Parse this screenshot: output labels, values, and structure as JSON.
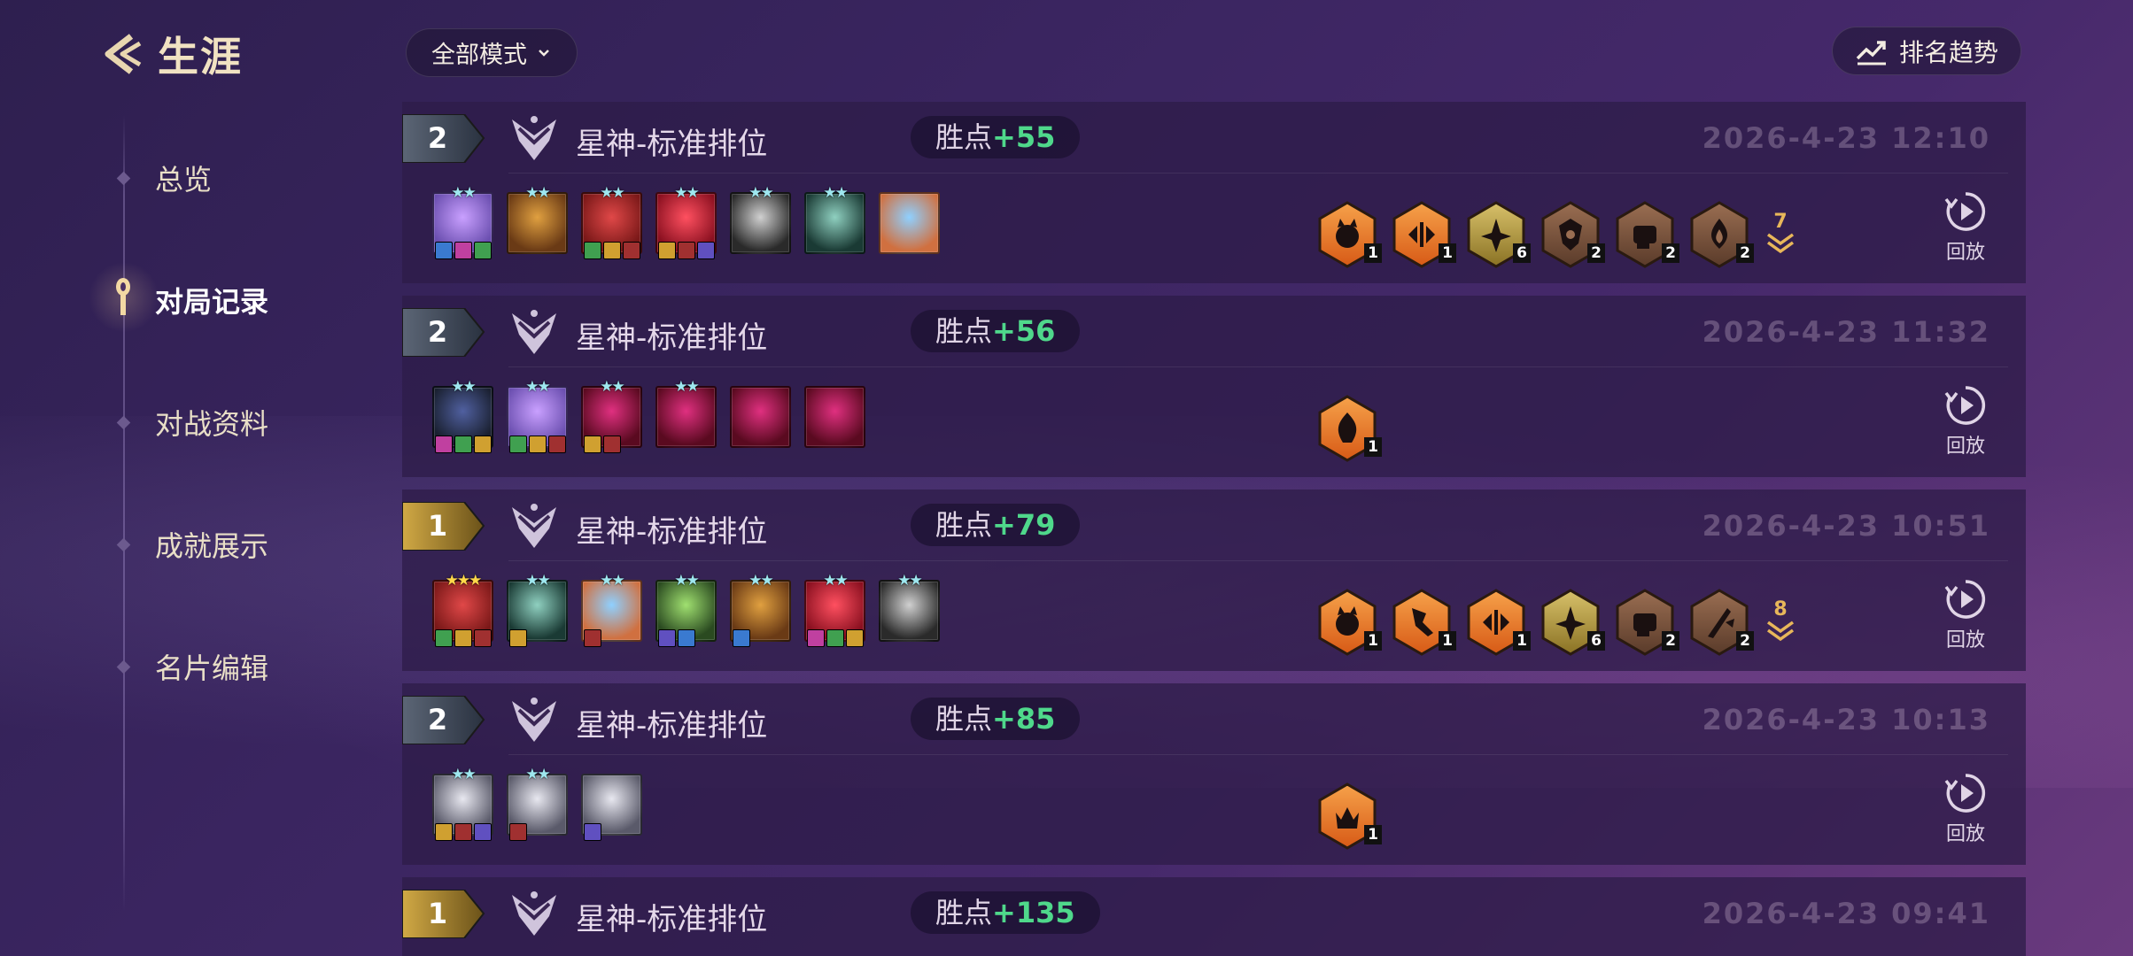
{
  "header": {
    "title": "生涯"
  },
  "sidebar": {
    "items": [
      {
        "label": "总览",
        "active": false
      },
      {
        "label": "对局记录",
        "active": true
      },
      {
        "label": "对战资料",
        "active": false
      },
      {
        "label": "成就展示",
        "active": false
      },
      {
        "label": "名片编辑",
        "active": false
      }
    ]
  },
  "toolbar": {
    "mode_filter": "全部模式",
    "trend_label": "排名趋势"
  },
  "colors": {
    "accent_gold": "#f1e2c2",
    "points_green": "#4fd88b",
    "more_gold": "#e8b75a"
  },
  "matches": [
    {
      "rank": "2",
      "mode": "星神-标准排位",
      "points_label": "胜点",
      "points_value": "+55",
      "time": "2026-4-23   12:10",
      "replay_label": "回放",
      "more_count": "7",
      "champions": [
        {
          "stars": 2,
          "icon": "champion-purple-fox",
          "items": 3
        },
        {
          "stars": 2,
          "icon": "champion-gold-armor",
          "items": 0
        },
        {
          "stars": 2,
          "icon": "champion-red-blade",
          "items": 3
        },
        {
          "stars": 2,
          "icon": "champion-red-mage",
          "items": 3
        },
        {
          "stars": 2,
          "icon": "champion-dark-knight",
          "items": 0
        },
        {
          "stars": 2,
          "icon": "champion-green-mech",
          "items": 0
        },
        {
          "stars": 0,
          "icon": "champion-blue-hair",
          "items": 0
        }
      ],
      "traits": [
        {
          "icon": "cat-trait-icon",
          "tier": "orange",
          "count": "1"
        },
        {
          "icon": "arrows-trait-icon",
          "tier": "orange",
          "count": "1"
        },
        {
          "icon": "star-trait-icon",
          "tier": "gold",
          "count": "6"
        },
        {
          "icon": "shield-trait-icon",
          "tier": "bronze",
          "count": "2"
        },
        {
          "icon": "fist-trait-icon",
          "tier": "bronze",
          "count": "2"
        },
        {
          "icon": "drop-trait-icon",
          "tier": "bronze",
          "count": "2"
        }
      ]
    },
    {
      "rank": "2",
      "mode": "星神-标准排位",
      "points_label": "胜点",
      "points_value": "+56",
      "time": "2026-4-23   11:32",
      "replay_label": "回放",
      "more_count": "",
      "champions": [
        {
          "stars": 2,
          "icon": "champion-shadow",
          "items": 3
        },
        {
          "stars": 2,
          "icon": "champion-purple-fox",
          "items": 3
        },
        {
          "stars": 2,
          "icon": "champion-pink-demon",
          "items": 2
        },
        {
          "stars": 2,
          "icon": "champion-pink-demon",
          "items": 0
        },
        {
          "stars": 0,
          "icon": "champion-pink-demon",
          "items": 0
        },
        {
          "stars": 0,
          "icon": "champion-pink-demon",
          "items": 0
        }
      ],
      "traits": [
        {
          "icon": "flame-trait-icon",
          "tier": "orange",
          "count": "1"
        }
      ]
    },
    {
      "rank": "1",
      "mode": "星神-标准排位",
      "points_label": "胜点",
      "points_value": "+79",
      "time": "2026-4-23   10:51",
      "replay_label": "回放",
      "more_count": "8",
      "champions": [
        {
          "stars": 3,
          "icon": "champion-red-blade",
          "items": 3
        },
        {
          "stars": 2,
          "icon": "champion-green-mech",
          "items": 1
        },
        {
          "stars": 2,
          "icon": "champion-blue-hair",
          "items": 1
        },
        {
          "stars": 2,
          "icon": "champion-green-elf",
          "items": 2
        },
        {
          "stars": 2,
          "icon": "champion-gold-armor",
          "items": 1
        },
        {
          "stars": 2,
          "icon": "champion-red-mage",
          "items": 3
        },
        {
          "stars": 2,
          "icon": "champion-dark-knight",
          "items": 0
        }
      ],
      "traits": [
        {
          "icon": "cat-trait-icon",
          "tier": "orange",
          "count": "1"
        },
        {
          "icon": "kick-trait-icon",
          "tier": "orange",
          "count": "1"
        },
        {
          "icon": "arrows-trait-icon",
          "tier": "orange",
          "count": "1"
        },
        {
          "icon": "star-trait-icon",
          "tier": "gold",
          "count": "6"
        },
        {
          "icon": "fist-trait-icon",
          "tier": "bronze",
          "count": "2"
        },
        {
          "icon": "blade-trait-icon",
          "tier": "bronze",
          "count": "2"
        }
      ]
    },
    {
      "rank": "2",
      "mode": "星神-标准排位",
      "points_label": "胜点",
      "points_value": "+85",
      "time": "2026-4-23   10:13",
      "replay_label": "回放",
      "more_count": "",
      "champions": [
        {
          "stars": 2,
          "icon": "champion-white-hair",
          "items": 3
        },
        {
          "stars": 2,
          "icon": "champion-white-hair",
          "items": 1
        },
        {
          "stars": 0,
          "icon": "champion-white-hair",
          "items": 1
        }
      ],
      "traits": [
        {
          "icon": "crown-trait-icon",
          "tier": "orange",
          "count": "1"
        }
      ]
    },
    {
      "rank": "1",
      "mode": "星神-标准排位",
      "points_label": "胜点",
      "points_value": "+135",
      "time": "2026-4-23   09:41",
      "replay_label": "",
      "more_count": "",
      "champions": [],
      "traits": []
    }
  ]
}
